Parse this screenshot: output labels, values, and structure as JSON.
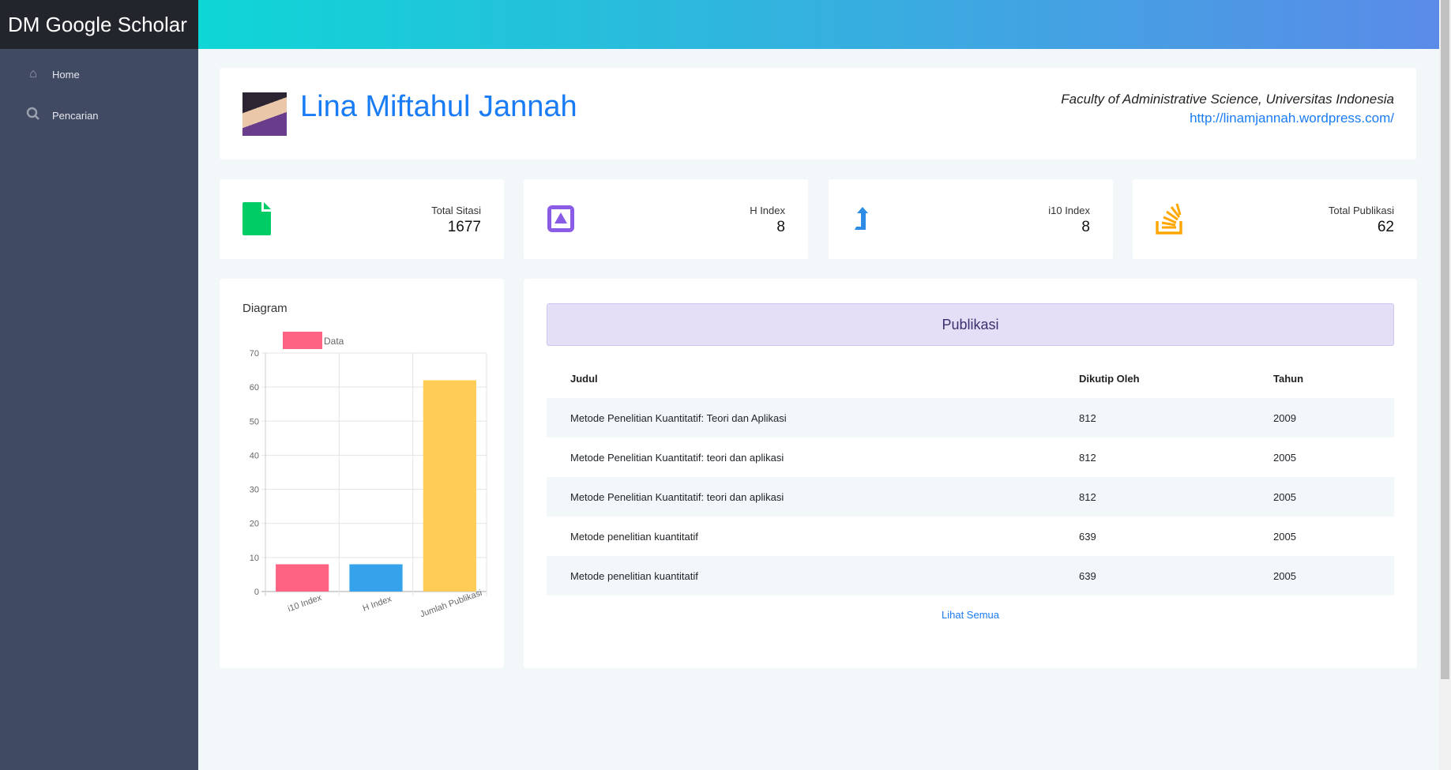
{
  "app": {
    "title": "DM Google Scholar"
  },
  "sidebar": {
    "items": [
      {
        "label": "Home",
        "icon": "home-icon"
      },
      {
        "label": "Pencarian",
        "icon": "search-icon"
      }
    ]
  },
  "profile": {
    "name": "Lina Miftahul Jannah",
    "affiliation": "Faculty of Administrative Science, Universitas Indonesia",
    "url": "http://linamjannah.wordpress.com/"
  },
  "stats": [
    {
      "label": "Total Sitasi",
      "value": "1677",
      "icon": "file-icon",
      "color": "#00cc66"
    },
    {
      "label": "H Index",
      "value": "8",
      "icon": "caret-square-up-icon",
      "color": "#8a5ce6"
    },
    {
      "label": "i10 Index",
      "value": "8",
      "icon": "level-up-icon",
      "color": "#2f8ce6"
    },
    {
      "label": "Total Publikasi",
      "value": "62",
      "icon": "stack-overflow-icon",
      "color": "#ffa700"
    }
  ],
  "diagram": {
    "title": "Diagram"
  },
  "chart_data": {
    "type": "bar",
    "categories": [
      "i10 Index",
      "H Index",
      "Jumlah Publikasi"
    ],
    "series": [
      {
        "name": "Data",
        "values": [
          8,
          8,
          62
        ],
        "colors": [
          "#ff6384",
          "#36a2eb",
          "#ffcd56"
        ]
      }
    ],
    "ylim": [
      0,
      70
    ],
    "yticks": [
      0,
      10,
      20,
      30,
      40,
      50,
      60,
      70
    ],
    "grid": true,
    "legend": "top"
  },
  "publikasi": {
    "title": "Publikasi",
    "columns": [
      "Judul",
      "Dikutip Oleh",
      "Tahun"
    ],
    "rows": [
      [
        "Metode Penelitian Kuantitatif: Teori dan Aplikasi",
        "812",
        "2009"
      ],
      [
        "Metode Penelitian Kuantitatif: teori dan aplikasi",
        "812",
        "2005"
      ],
      [
        "Metode Penelitian Kuantitatif: teori dan aplikasi",
        "812",
        "2005"
      ],
      [
        "Metode penelitian kuantitatif",
        "639",
        "2005"
      ],
      [
        "Metode penelitian kuantitatif",
        "639",
        "2005"
      ]
    ],
    "more_label": "Lihat Semua"
  }
}
